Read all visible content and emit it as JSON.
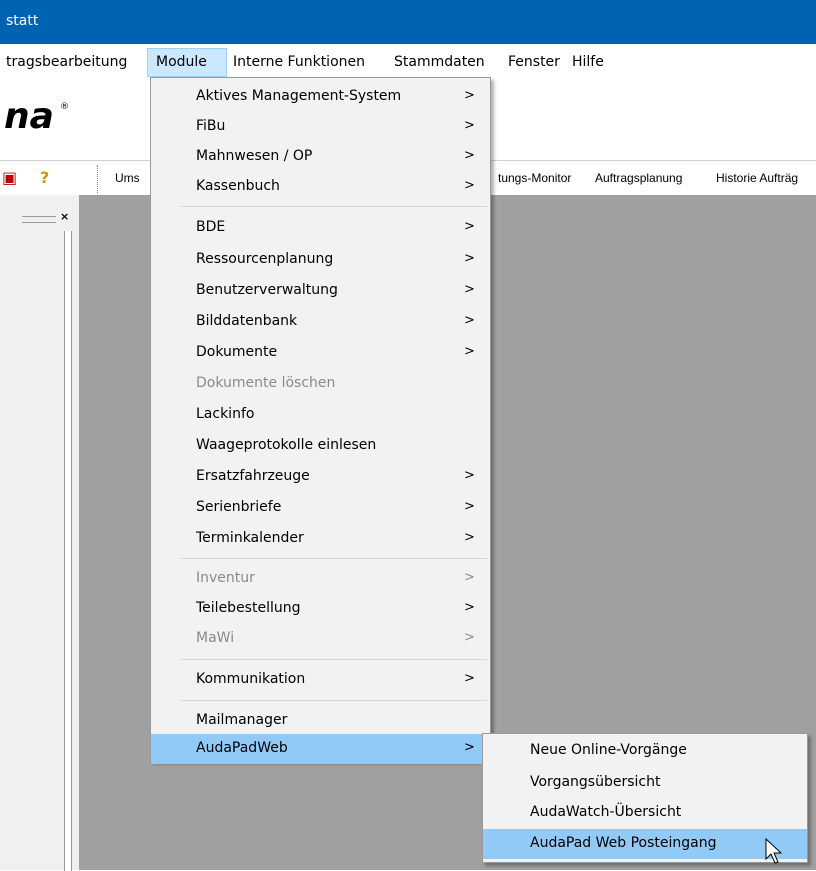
{
  "window": {
    "title": "statt"
  },
  "menubar": {
    "items": [
      {
        "label": "tragsbearbeitung"
      },
      {
        "label": "Module"
      },
      {
        "label": "Interne Funktionen"
      },
      {
        "label": "Stammdaten"
      },
      {
        "label": "Fenster"
      },
      {
        "label": "Hilfe"
      }
    ]
  },
  "logo": {
    "text": "na",
    "mark": "®"
  },
  "toolbar": {
    "items": [
      {
        "label": "Ums"
      },
      {
        "label": "tungs-Monitor"
      },
      {
        "label": "Auftragsplanung"
      },
      {
        "label": "Historie Aufträg"
      }
    ],
    "icons": [
      "app-icon",
      "help-icon"
    ]
  },
  "panel": {
    "close_label": "×"
  },
  "module_menu": {
    "items": [
      {
        "label": "Aktives Management-System",
        "submenu": true
      },
      {
        "label": "FiBu",
        "submenu": true
      },
      {
        "label": "Mahnwesen / OP",
        "submenu": true
      },
      {
        "label": "Kassenbuch",
        "submenu": true
      },
      {
        "label": "BDE",
        "submenu": true
      },
      {
        "label": "Ressourcenplanung",
        "submenu": true
      },
      {
        "label": "Benutzerverwaltung",
        "submenu": true
      },
      {
        "label": "Bilddatenbank",
        "submenu": true
      },
      {
        "label": "Dokumente",
        "submenu": true
      },
      {
        "label": "Dokumente löschen",
        "disabled": true
      },
      {
        "label": "Lackinfo"
      },
      {
        "label": "Waageprotokolle einlesen"
      },
      {
        "label": "Ersatzfahrzeuge",
        "submenu": true
      },
      {
        "label": "Serienbriefe",
        "submenu": true
      },
      {
        "label": "Terminkalender",
        "submenu": true
      },
      {
        "label": "Inventur",
        "submenu": true,
        "disabled": true
      },
      {
        "label": "Teilebestellung",
        "submenu": true
      },
      {
        "label": "MaWi",
        "submenu": true,
        "disabled": true
      },
      {
        "label": "Kommunikation",
        "submenu": true
      },
      {
        "label": "Mailmanager"
      },
      {
        "label": "AudaPadWeb",
        "submenu": true,
        "highlighted": true
      }
    ],
    "arrow": ">"
  },
  "audapad_submenu": {
    "items": [
      {
        "label": "Neue Online-Vorgänge"
      },
      {
        "label": "Vorgangsübersicht"
      },
      {
        "label": "AudaWatch-Übersicht"
      },
      {
        "label": "AudaPad Web Posteingang",
        "highlighted": true
      }
    ]
  },
  "colors": {
    "titlebar": "#0063b1",
    "menu_highlight": "#91c9f7",
    "menubar_active": "#cce8ff",
    "mdi_background": "#a0a0a0",
    "disabled_text": "#8a8a8a"
  }
}
